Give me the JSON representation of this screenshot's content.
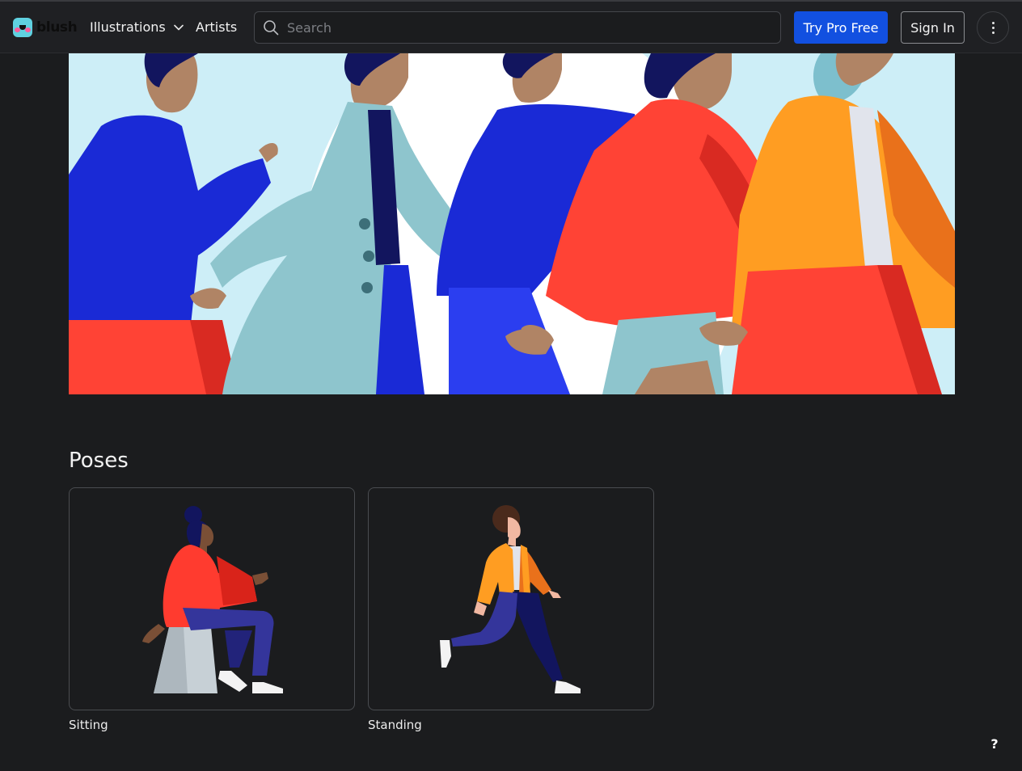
{
  "brand": {
    "name": "blush"
  },
  "nav": {
    "illustrations_label": "Illustrations",
    "artists_label": "Artists"
  },
  "search": {
    "placeholder": "Search",
    "value": ""
  },
  "header_actions": {
    "try_pro_label": "Try Pro Free",
    "sign_in_label": "Sign In"
  },
  "icons": {
    "logo": "blush-logo-icon",
    "dropdown": "chevron-down-icon",
    "search": "search-icon",
    "more": "more-vertical-icon"
  },
  "colors": {
    "accent": "#1250e0",
    "background": "#1b1c1e",
    "topbar": "#1f2023"
  },
  "poses": {
    "title": "Poses",
    "items": [
      {
        "label": "Sitting"
      },
      {
        "label": "Standing"
      }
    ]
  },
  "help": {
    "label": "?"
  }
}
